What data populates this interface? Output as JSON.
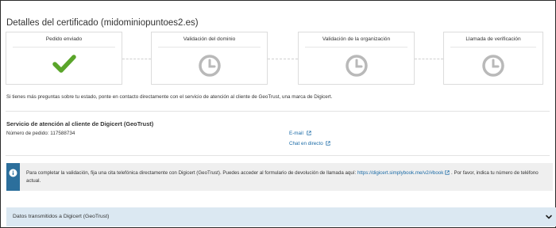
{
  "title": "Detalles del certificado (midominiopuntoes2.es)",
  "steps": [
    {
      "label": "Pedido enviado",
      "status": "done",
      "icon": "check-icon"
    },
    {
      "label": "Validación del dominio",
      "status": "pending",
      "icon": "clock-icon"
    },
    {
      "label": "Validación de la organización",
      "status": "pending",
      "icon": "clock-icon"
    },
    {
      "label": "Llamada de verificación",
      "status": "pending",
      "icon": "clock-icon"
    }
  ],
  "contact_note": "Si tienes más preguntas sobre tu estado, ponte en contacto directamente con el servicio de atención al cliente de GeoTrust, una marca de Digicert.",
  "support": {
    "title": "Servicio de atención al cliente de Digicert (GeoTrust)",
    "order_label": "Número de pedido: 117588734",
    "email_link": "E-mail",
    "chat_link": "Chat en directo"
  },
  "info": {
    "text_before": "Para completar la validación, fija una cita telefónica directamente con Digicert (GeoTrust). Puedes acceder al formulario de devolución de llamada aquí: ",
    "link": "https://digicert.simplybook.me/v2/#book",
    "text_after": " . Por favor, indica tu número de teléfono actual."
  },
  "datos_label": "Datos transmitidos a Digicert (GeoTrust)",
  "colors": {
    "done": "#5aa52a",
    "pending": "#b9b9b9",
    "link": "#1a6aa6",
    "info_strip": "#2c6f9c",
    "datos_bg": "#dbe8f2"
  }
}
